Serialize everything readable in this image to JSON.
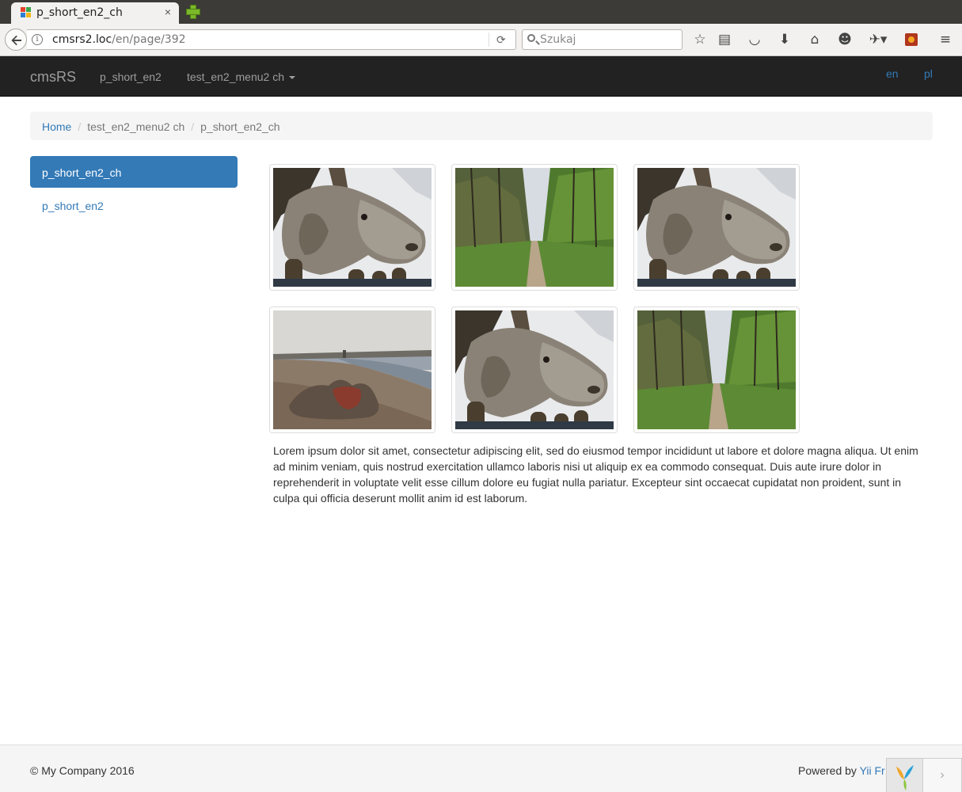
{
  "browser": {
    "tab_title": "p_short_en2_ch",
    "tab_close": "×",
    "url_host": "cmsrs2.loc",
    "url_path": "/en/page/392",
    "search_placeholder": "Szukaj"
  },
  "site": {
    "brand": "cmsRS",
    "nav": [
      {
        "label": "p_short_en2"
      },
      {
        "label": "test_en2_menu2 ch"
      }
    ],
    "languages": [
      {
        "label": "en"
      },
      {
        "label": "pl"
      }
    ]
  },
  "breadcrumb": [
    {
      "label": "Home"
    },
    {
      "label": "test_en2_menu2 ch"
    },
    {
      "label": "p_short_en2_ch"
    }
  ],
  "sidebar": {
    "items": [
      {
        "label": "p_short_en2_ch",
        "active": true
      },
      {
        "label": "p_short_en2",
        "active": false
      }
    ]
  },
  "gallery": {
    "images": [
      {
        "subject": "donkey"
      },
      {
        "subject": "forest-path"
      },
      {
        "subject": "donkey"
      },
      {
        "subject": "beach-camel"
      },
      {
        "subject": "donkey"
      },
      {
        "subject": "forest-path"
      }
    ]
  },
  "content": {
    "text": "Lorem ipsum dolor sit amet, consectetur adipiscing elit, sed do eiusmod tempor incididunt ut labore et dolore magna aliqua. Ut enim ad minim veniam, quis nostrud exercitation ullamco laboris nisi ut aliquip ex ea commodo consequat. Duis aute irure dolor in reprehenderit in voluptate velit esse cillum dolore eu fugiat nulla pariatur. Excepteur sint occaecat cupidatat non proident, sunt in culpa qui officia deserunt mollit anim id est laborum."
  },
  "footer": {
    "copyright": "© My Company 2016",
    "powered_prefix": "Powered by ",
    "powered_link": "Yii Fr",
    "debug_toggle": "›"
  },
  "colors": {
    "accent": "#337ab7",
    "navbar": "#222222"
  }
}
